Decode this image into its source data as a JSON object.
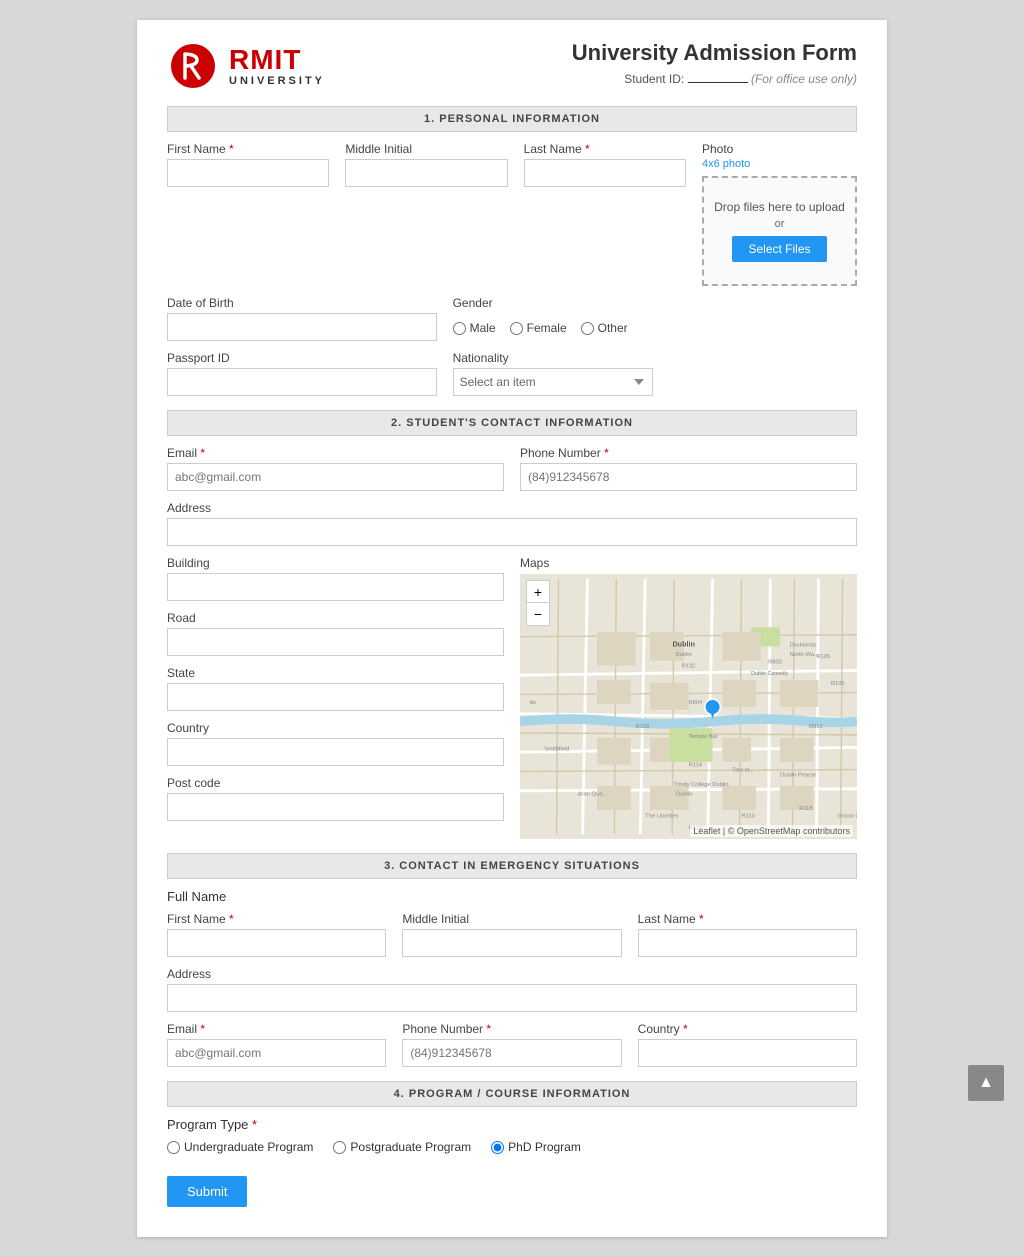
{
  "header": {
    "logo_rmit": "RMIT",
    "logo_university": "UNIVERSITY",
    "form_title": "University Admission Form",
    "student_id_label": "Student ID:",
    "student_id_value": "______",
    "office_use": "(For office use only)"
  },
  "section1": {
    "title": "1. PERSONAL INFORMATION",
    "first_name_label": "First Name",
    "middle_initial_label": "Middle Initial",
    "last_name_label": "Last Name",
    "dob_label": "Date of Birth",
    "gender_label": "Gender",
    "gender_options": [
      "Male",
      "Female",
      "Other"
    ],
    "passport_label": "Passport ID",
    "nationality_label": "Nationality",
    "nationality_placeholder": "Select an item",
    "photo_label": "Photo",
    "photo_size": "4x6 photo",
    "drop_text": "Drop files here to upload",
    "or_text": "or",
    "select_files_btn": "Select Files"
  },
  "section2": {
    "title": "2. STUDENT'S CONTACT INFORMATION",
    "email_label": "Email",
    "email_placeholder": "abc@gmail.com",
    "phone_label": "Phone Number",
    "phone_placeholder": "(84)912345678",
    "address_label": "Address",
    "building_label": "Building",
    "road_label": "Road",
    "state_label": "State",
    "country_label": "Country",
    "postcode_label": "Post code",
    "maps_label": "Maps",
    "map_zoom_in": "+",
    "map_zoom_out": "−",
    "map_attribution": "Leaflet | © OpenStreetMap contributors"
  },
  "section3": {
    "title": "3. CONTACT IN EMERGENCY SITUATIONS",
    "full_name_label": "Full Name",
    "first_name_label": "First Name",
    "middle_initial_label": "Middle Initial",
    "last_name_label": "Last Name",
    "address_label": "Address",
    "email_label": "Email",
    "email_placeholder": "abc@gmail.com",
    "phone_label": "Phone Number",
    "phone_placeholder": "(84)912345678",
    "country_label": "Country"
  },
  "section4": {
    "title": "4. PROGRAM / COURSE INFORMATION",
    "program_type_label": "Program Type",
    "program_options": [
      "Undergraduate Program",
      "Postgraduate Program",
      "PhD Program"
    ],
    "submit_btn": "Submit"
  },
  "scroll_top": "▲"
}
